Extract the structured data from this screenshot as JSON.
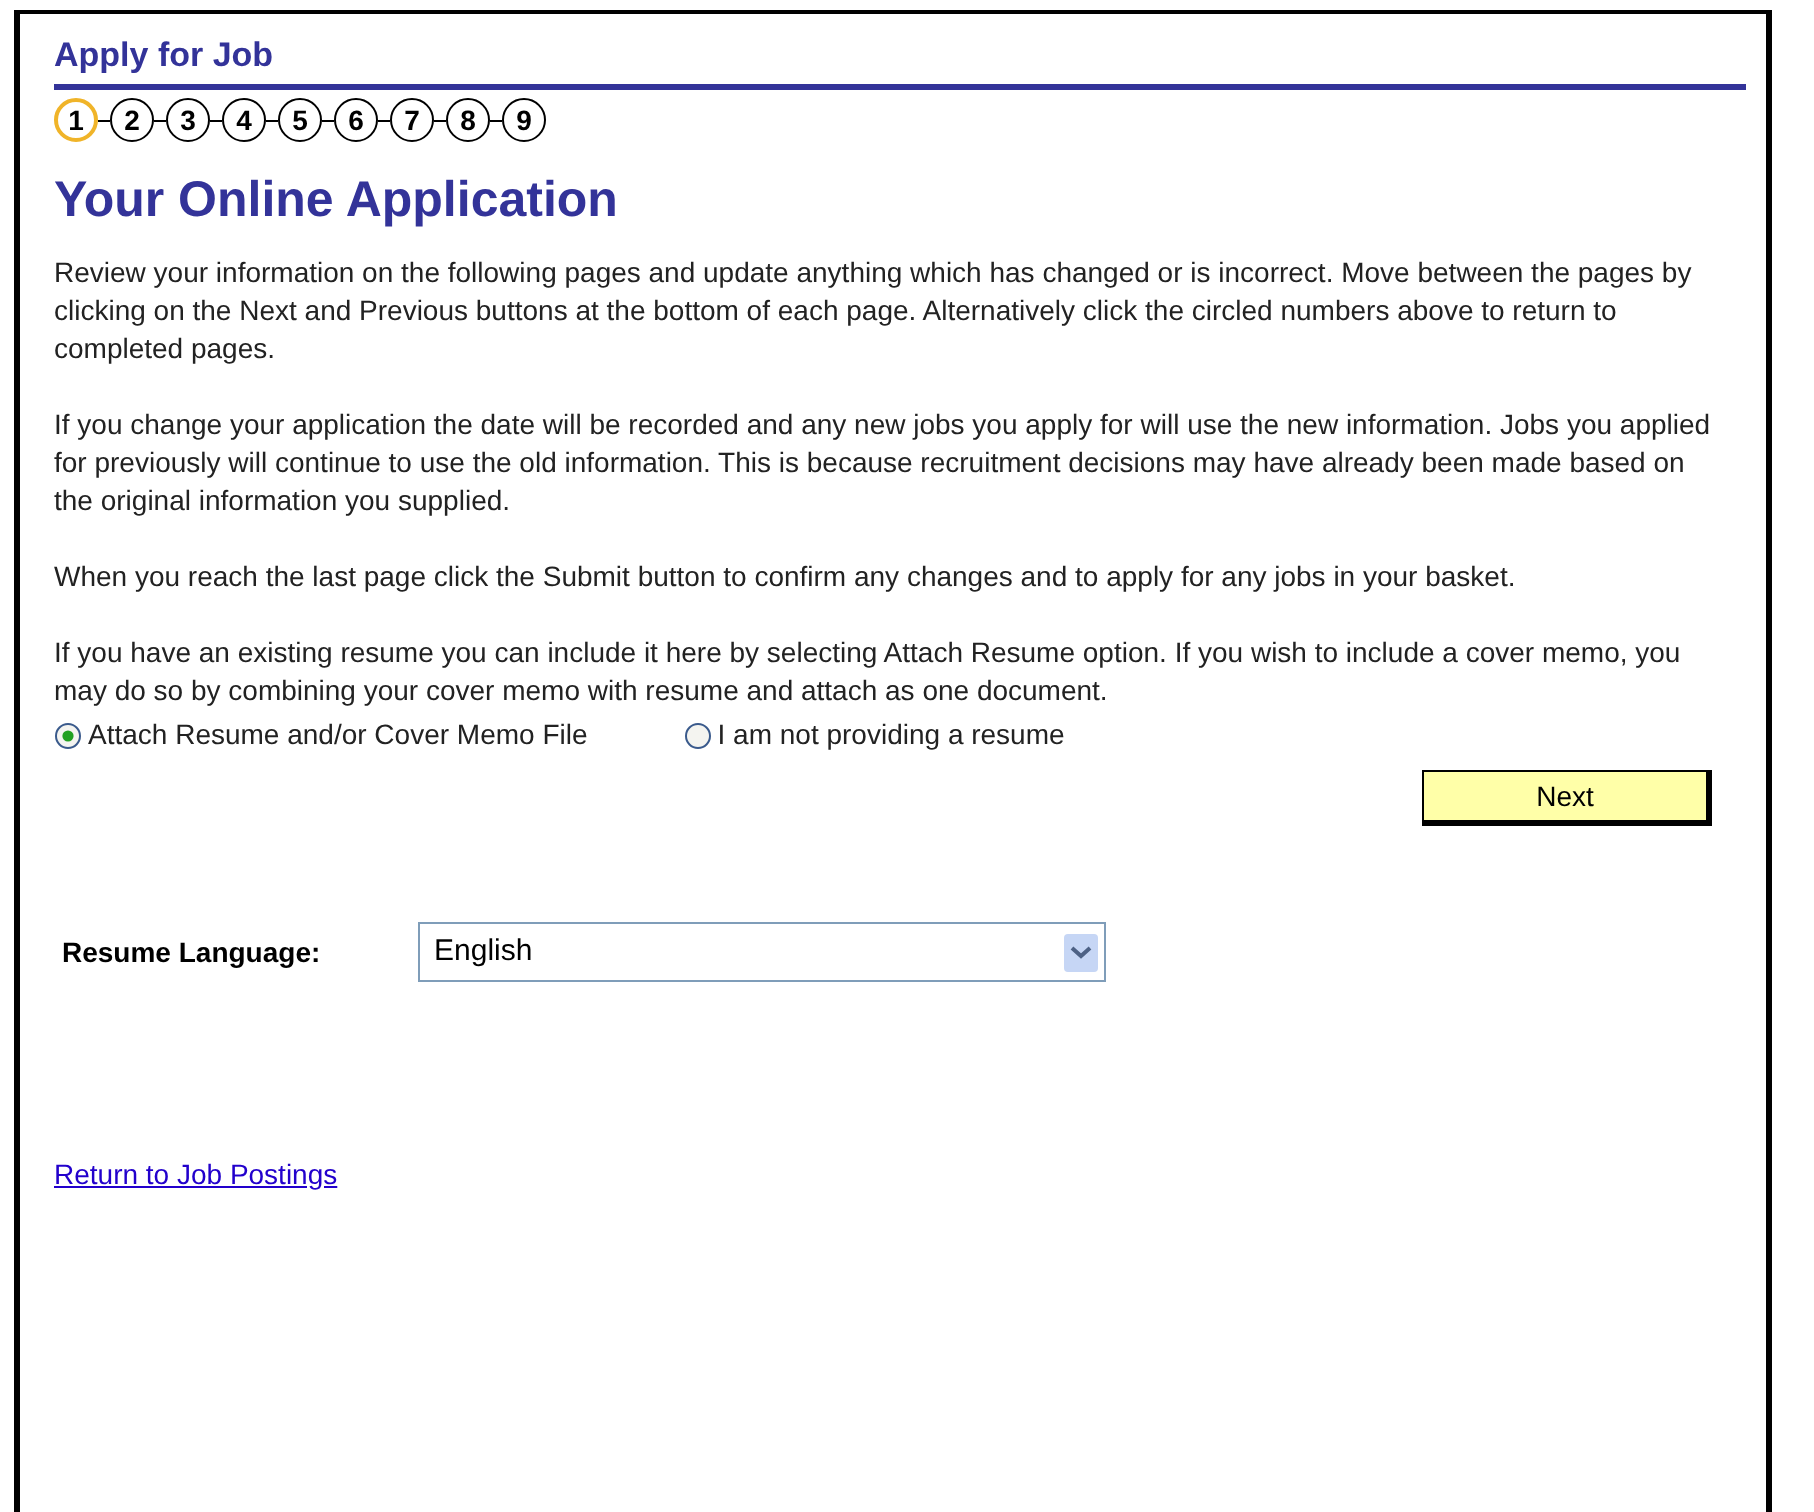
{
  "page_title": "Apply for Job",
  "steps": [
    {
      "label": "1",
      "selected": true
    },
    {
      "label": "2",
      "selected": false
    },
    {
      "label": "3",
      "selected": false
    },
    {
      "label": "4",
      "selected": false
    },
    {
      "label": "5",
      "selected": false
    },
    {
      "label": "6",
      "selected": false
    },
    {
      "label": "7",
      "selected": false
    },
    {
      "label": "8",
      "selected": false
    },
    {
      "label": "9",
      "selected": false
    }
  ],
  "heading": "Your Online Application",
  "paragraphs": [
    "Review your information on the following pages and update anything which has changed or is incorrect. Move between the pages by clicking on the Next and Previous buttons at the bottom of each page. Alternatively click the circled numbers above to return to completed pages.",
    "If you change your application the date will be recorded and any new jobs you apply for will use the new information. Jobs you applied for previously will continue to use the old information. This is because recruitment decisions may have already been made based on the original information you supplied.",
    "When you reach the last page click the Submit button to confirm any changes and to apply for any jobs in your basket.",
    "If you have an existing resume you can include it here by selecting Attach Resume option.  If you wish to include a cover memo, you may do so by combining your cover memo with resume and attach as one document."
  ],
  "resume_options": [
    {
      "label": "Attach Resume and/or Cover Memo File",
      "selected": true
    },
    {
      "label": "I am not providing a resume",
      "selected": false
    }
  ],
  "next_button": "Next",
  "resume_language": {
    "label": "Resume Language:",
    "value": "English"
  },
  "return_link": "Return to Job Postings"
}
